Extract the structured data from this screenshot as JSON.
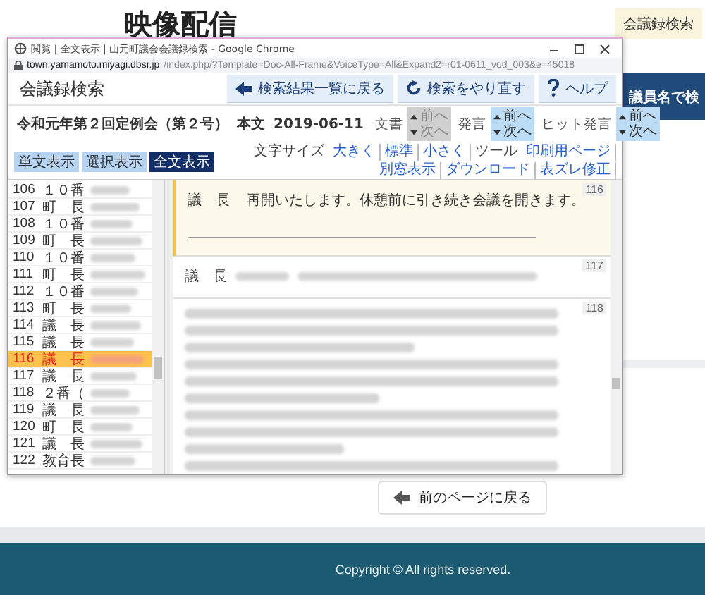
{
  "page": {
    "heading": "映像配信",
    "badge": "会議録検索",
    "side_button": "議員名で検",
    "back_button": "前のページに戻る",
    "copyright": "Copyright ©  All rights reserved."
  },
  "popup": {
    "title": "閲覧 | 全文表示 | 山元町議会会議録検索 - Google Chrome",
    "url_host": "town.yamamoto.miyagi.dbsr.jp",
    "url_path": "/index.php/?Template=Doc-All-Frame&VoiceType=All&Expand2=r01-0611_vod_003&e=45018",
    "app_title": "会議録検索",
    "toolbar_buttons": [
      {
        "label": "検索結果一覧に戻る",
        "kind": "back"
      },
      {
        "label": "検索をやり直す",
        "kind": "reload"
      },
      {
        "label": "ヘルプ",
        "kind": "help"
      }
    ],
    "meeting": "令和元年第２回定例会（第２号）",
    "section": "本文",
    "date": "2019-06-11",
    "navigators": [
      {
        "label": "文書",
        "prev": "前へ",
        "next": "次へ",
        "disabled": true
      },
      {
        "label": "発言",
        "prev": "前へ",
        "next": "次へ",
        "disabled": false
      },
      {
        "label": "ヒット発言",
        "prev": "前へ",
        "next": "次へ",
        "disabled": false
      }
    ],
    "view_tabs": [
      {
        "label": "単文表示",
        "selected": false
      },
      {
        "label": "選択表示",
        "selected": false
      },
      {
        "label": "全文表示",
        "selected": true
      }
    ],
    "tools": [
      {
        "label": "文字サイズ",
        "kind": "label"
      },
      {
        "label": "大きく",
        "kind": "link"
      },
      {
        "label": "標準",
        "kind": "link"
      },
      {
        "label": "小さく",
        "kind": "link"
      },
      {
        "label": "ツール",
        "kind": "label"
      },
      {
        "label": "印刷用ページ",
        "kind": "link"
      },
      {
        "label": "別窓表示",
        "kind": "link"
      },
      {
        "label": "ダウンロード",
        "kind": "link"
      },
      {
        "label": "表ズレ修正",
        "kind": "link"
      }
    ],
    "speakers": [
      {
        "number": "106",
        "role": "１０番",
        "selected": false
      },
      {
        "number": "107",
        "role": "町　長",
        "selected": false
      },
      {
        "number": "108",
        "role": "１０番",
        "selected": false
      },
      {
        "number": "109",
        "role": "町　長",
        "selected": false
      },
      {
        "number": "110",
        "role": "１０番",
        "selected": false
      },
      {
        "number": "111",
        "role": "町　長",
        "selected": false
      },
      {
        "number": "112",
        "role": "１０番",
        "selected": false
      },
      {
        "number": "113",
        "role": "町　長",
        "selected": false
      },
      {
        "number": "114",
        "role": "議　長",
        "selected": false
      },
      {
        "number": "115",
        "role": "議　長",
        "selected": false
      },
      {
        "number": "116",
        "role": "議　長",
        "selected": true
      },
      {
        "number": "117",
        "role": "議　長",
        "selected": false
      },
      {
        "number": "118",
        "role": "２番（",
        "selected": false
      },
      {
        "number": "119",
        "role": "議　長",
        "selected": false
      },
      {
        "number": "120",
        "role": "町　長",
        "selected": false
      },
      {
        "number": "121",
        "role": "議　長",
        "selected": false
      },
      {
        "number": "122",
        "role": "教育長",
        "selected": false
      }
    ],
    "remarks": [
      {
        "number": "116",
        "speaker": "議　長",
        "text": "再開いたします。休憩前に引き続き会議を開きます。",
        "selected": true
      },
      {
        "number": "117",
        "speaker": "議　長",
        "selected": false
      },
      {
        "number": "118",
        "selected": false
      }
    ]
  }
}
